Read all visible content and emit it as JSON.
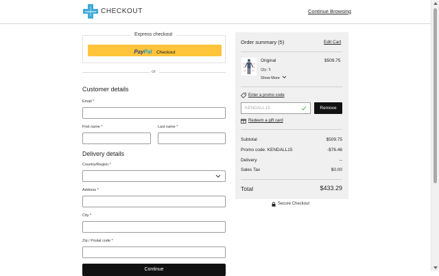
{
  "header": {
    "brand": "CHECKOUT",
    "continue_label": "Continue Browsing"
  },
  "express": {
    "title": "Express checkout",
    "paypal_pay": "Pay",
    "paypal_pal": "Pal",
    "paypal_label": "Checkout",
    "or_label": "or"
  },
  "customer": {
    "title": "Customer details",
    "email_label": "Email *",
    "first_name_label": "First name *",
    "last_name_label": "Last name *"
  },
  "delivery": {
    "title": "Delivery details",
    "country_label": "Country/Region *",
    "address_label": "Address *",
    "city_label": "City *",
    "zip_label": "Zip / Postal code *"
  },
  "continue_button": "Continue",
  "summary": {
    "title": "Order summary (5)",
    "edit_cart": "Edit Cart",
    "item": {
      "name": "Original",
      "price": "$509.75",
      "qty": "Qty: 5",
      "show_more": "Show More"
    },
    "promo_link": "Enter a promo code",
    "promo_value": "KENDALL15",
    "remove_label": "Remove",
    "gift_link": "Redeem a gift card",
    "rows": {
      "subtotal_label": "Subtotal",
      "subtotal_value": "$509.75",
      "promo_label": "Promo code: KENDALL15",
      "promo_value": "-$76.46",
      "delivery_label": "Delivery",
      "delivery_value": "--",
      "tax_label": "Sales Tax",
      "tax_value": "$0.00"
    },
    "total_label": "Total",
    "total_value": "$433.29",
    "secure_label": "Secure Checkout"
  },
  "colors": {
    "paypal_yellow": "#ffc439",
    "brand_blue": "#3fa9d8",
    "summary_bg": "#f0f0f0",
    "button_black": "#111111",
    "check_green": "#4caf50"
  }
}
